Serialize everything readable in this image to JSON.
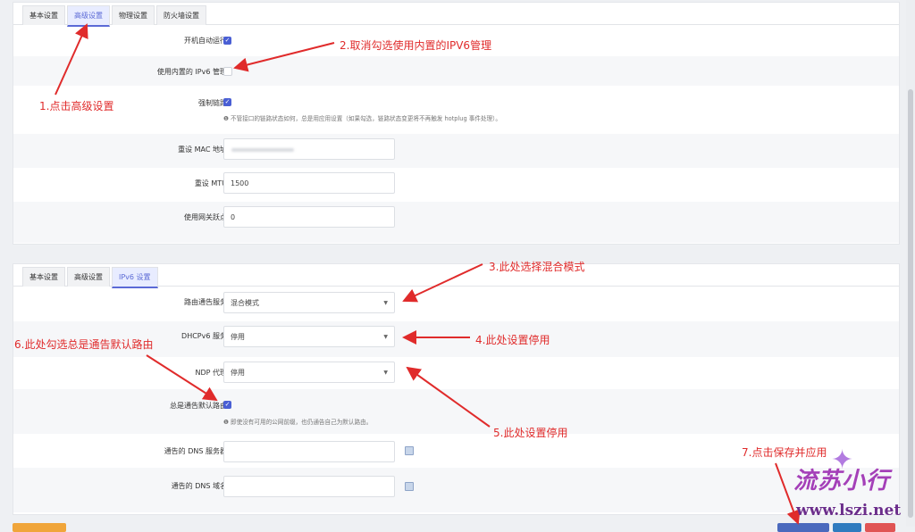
{
  "panel1": {
    "tabs": [
      "基本设置",
      "高级设置",
      "物理设置",
      "防火墙设置"
    ],
    "active_tab": 1,
    "rows": [
      {
        "label": "开机自动运行",
        "type": "checkbox",
        "checked": true
      },
      {
        "label": "使用内置的 IPv6 管理",
        "type": "checkbox",
        "checked": false
      },
      {
        "label": "强制链路",
        "type": "checkbox",
        "checked": true,
        "help": "❶ 不管接口的链路状态如何，总是用应用设置（如果勾选，链路状态变更将不再触发 hotplug 事件处理）。"
      },
      {
        "label": "重设 MAC 地址",
        "type": "input",
        "value": ""
      },
      {
        "label": "重设 MTU",
        "type": "input",
        "value": "1500"
      },
      {
        "label": "使用网关跃点",
        "type": "input",
        "value": "0"
      }
    ]
  },
  "panel2": {
    "tabs": [
      "基本设置",
      "高级设置",
      "IPv6 设置"
    ],
    "active_tab": 2,
    "rows": [
      {
        "label": "路由通告服务",
        "type": "select",
        "value": "混合模式"
      },
      {
        "label": "DHCPv6 服务",
        "type": "select",
        "value": "停用"
      },
      {
        "label": "NDP 代理",
        "type": "select",
        "value": "停用"
      },
      {
        "label": "总是通告默认路由",
        "type": "checkbox",
        "checked": true,
        "help": "❶ 即使没有可用的公网前缀，也仍通告自己为默认路由。"
      },
      {
        "label": "通告的 DNS 服务器",
        "type": "input",
        "value": ""
      },
      {
        "label": "通告的 DNS 域名",
        "type": "input",
        "value": ""
      }
    ]
  },
  "annotations": {
    "a1": "1.点击高级设置",
    "a2": "2.取消勾选使用内置的IPV6管理",
    "a3": "3.此处选择混合模式",
    "a4": "4.此处设置停用",
    "a5": "5.此处设置停用",
    "a6": "6.此处勾选总是通告默认路由",
    "a7": "7.点击保存并应用"
  },
  "watermark": {
    "signature": "流苏小行",
    "url": "www.lszi.net"
  },
  "colors": {
    "accent": "#4a5fd4",
    "annotation": "#e02b2b"
  }
}
